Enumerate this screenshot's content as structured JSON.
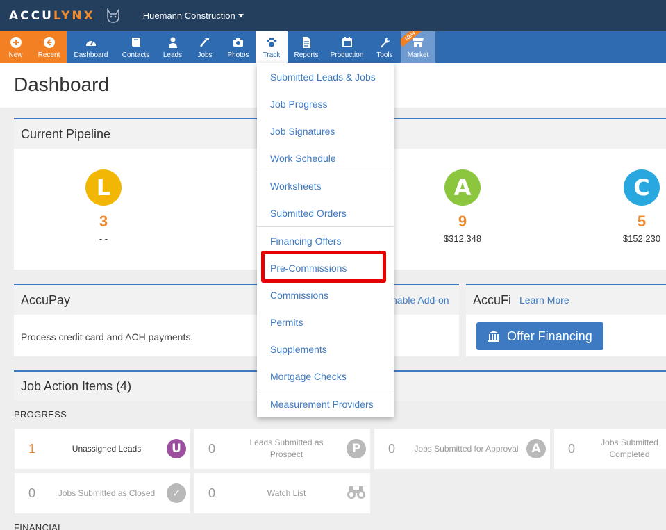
{
  "app": {
    "logo_prefix": "ACCU",
    "logo_suffix": "LYNX",
    "company": "Huemann Construction"
  },
  "nav": {
    "items": [
      {
        "label": "New",
        "icon": "plus-circle-icon"
      },
      {
        "label": "Recent",
        "icon": "back-arrow-circle-icon"
      },
      {
        "label": "Dashboard",
        "icon": "speedometer-icon"
      },
      {
        "label": "Contacts",
        "icon": "book-icon"
      },
      {
        "label": "Leads",
        "icon": "person-icon"
      },
      {
        "label": "Jobs",
        "icon": "hammer-icon"
      },
      {
        "label": "Photos",
        "icon": "camera-icon"
      },
      {
        "label": "Track",
        "icon": "paw-icon"
      },
      {
        "label": "Reports",
        "icon": "document-icon"
      },
      {
        "label": "Production",
        "icon": "calendar-icon"
      },
      {
        "label": "Tools",
        "icon": "wrench-icon"
      },
      {
        "label": "Market",
        "icon": "storefront-icon",
        "ribbon": "New"
      }
    ]
  },
  "page": {
    "title": "Dashboard"
  },
  "pipeline": {
    "title": "Current Pipeline",
    "columns": [
      {
        "letter": "L",
        "count": "3",
        "amount": "- -",
        "color": "#f2b705"
      },
      {
        "letter": "A",
        "count": "9",
        "amount": "$312,348",
        "color": "#8cc63f"
      },
      {
        "letter": "C",
        "count": "5",
        "amount": "$152,230",
        "color": "#29a8e0"
      }
    ]
  },
  "accupay": {
    "title": "AccuPay",
    "link": "nable Add-on",
    "description": "Process credit card and ACH payments."
  },
  "accufi": {
    "title": "AccuFi",
    "link": "Learn More",
    "button": "Offer Financing"
  },
  "job_actions": {
    "title": "Job Action Items (4)",
    "progress_label": "PROGRESS",
    "financial_label": "FINANCIAL",
    "tiles": [
      {
        "count": "1",
        "label": "Unassigned Leads",
        "badge": "U",
        "badge_color": "#9b4f9e"
      },
      {
        "count": "0",
        "label": "Leads Submitted as Prospect",
        "badge": "P",
        "badge_color": "#b9b9b9"
      },
      {
        "count": "0",
        "label": "Jobs Submitted for Approval",
        "badge": "A",
        "badge_color": "#b9b9b9"
      },
      {
        "count": "0",
        "label": "Jobs Submitted Completed",
        "badge": "",
        "badge_color": "#b9b9b9"
      },
      {
        "count": "0",
        "label": "Jobs Submitted as Closed",
        "badge": "✓",
        "badge_color": "#b9b9b9"
      },
      {
        "count": "0",
        "label": "Watch List",
        "badge": "binoculars-icon",
        "badge_color": "#b9b9b9"
      }
    ]
  },
  "track_menu": {
    "groups": [
      [
        "Submitted Leads & Jobs",
        "Job Progress",
        "Job Signatures",
        "Work Schedule"
      ],
      [
        "Worksheets",
        "Submitted Orders"
      ],
      [
        "Financing Offers",
        "Pre-Commissions",
        "Commissions",
        "Permits",
        "Supplements",
        "Mortgage Checks"
      ],
      [
        "Measurement Providers"
      ]
    ]
  },
  "colors": {
    "topbar": "#243f5e",
    "nav": "#2f6bb0",
    "orange": "#f48024",
    "link": "#3d7ac2",
    "highlight": "#e60000"
  }
}
